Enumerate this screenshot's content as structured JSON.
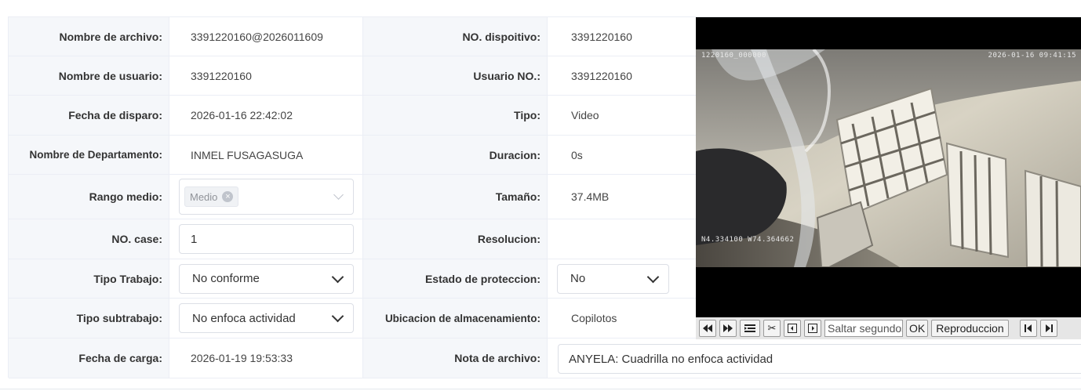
{
  "fields": {
    "file_name": {
      "label": "Nombre de archivo:",
      "value": "3391220160@2026011609"
    },
    "user_name": {
      "label": "Nombre de usuario:",
      "value": "3391220160"
    },
    "trigger_date": {
      "label": "Fecha de disparo:",
      "value": "2026-01-16 22:42:02"
    },
    "department": {
      "label": "Nombre de Departamento:",
      "value": "INMEL FUSAGASUGA"
    },
    "media_range": {
      "label": "Rango medio:",
      "tag": "Medio"
    },
    "case_no": {
      "label": "NO. case:",
      "value": "1"
    },
    "work_type": {
      "label": "Tipo Trabajo:",
      "value": "No conforme"
    },
    "work_subtype": {
      "label": "Tipo subtrabajo:",
      "value": "No enfoca actividad"
    },
    "upload_date": {
      "label": "Fecha de carga:",
      "value": "2026-01-19 19:53:33"
    },
    "device_no": {
      "label": "NO. dispoitivo:",
      "value": "3391220160"
    },
    "user_no": {
      "label": "Usuario NO.:",
      "value": "3391220160"
    },
    "type": {
      "label": "Tipo:",
      "value": "Video"
    },
    "duration": {
      "label": "Duracion:",
      "value": "0s"
    },
    "size": {
      "label": "Tamaño:",
      "value": "37.4MB"
    },
    "resolution": {
      "label": "Resolucion:",
      "value": ""
    },
    "protection": {
      "label": "Estado de proteccion:",
      "value": "No"
    },
    "storage": {
      "label": "Ubicacion de almacenamiento:",
      "value": "Copilotos"
    },
    "file_note": {
      "label": "Nota de archivo:",
      "value": "ANYELA: Cuadrilla no enfoca actividad"
    }
  },
  "video": {
    "osd_device": "1220160_000000",
    "osd_time": "2026-01-16 09:41:15",
    "osd_gps": "N4.334100  W74.364662"
  },
  "player_controls": {
    "rewind_icon": "rewind-icon",
    "forward_icon": "fast-forward-icon",
    "seek_placeholder": "Saltar segundos",
    "ok_label": "OK",
    "playback_label": "Reproduccion",
    "prev_label": "K"
  },
  "colors": {
    "label_bg": "#f5f7fa",
    "border": "#ebeef5"
  }
}
